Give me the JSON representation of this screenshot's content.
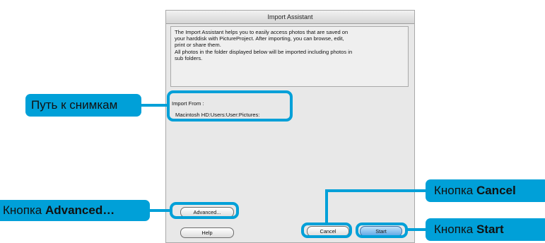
{
  "window": {
    "title": "Import Assistant",
    "description": [
      "The Import Assistant helps you to easily access photos that are saved on",
      "your harddisk with PictureProject. After importing, you can browse, edit,",
      "print or share them.",
      "All photos in the folder displayed below will be imported including photos in",
      "sub folders."
    ],
    "import_from_label": "Import From :",
    "import_path": "Macintosh HD:Users:User:Pictures:",
    "buttons": {
      "advanced": "Advanced...",
      "help": "Help",
      "cancel": "Cancel",
      "start": "Start"
    }
  },
  "callouts": {
    "path": "Путь к снимкам",
    "advanced_prefix": "Кнопка ",
    "advanced_bold": "Advanced…",
    "cancel_prefix": "Кнопка ",
    "cancel_bold": "Cancel",
    "start_prefix": "Кнопка ",
    "start_bold": "Start"
  },
  "colors": {
    "accent": "#00a0d8",
    "default_button": "#5da7e6"
  }
}
